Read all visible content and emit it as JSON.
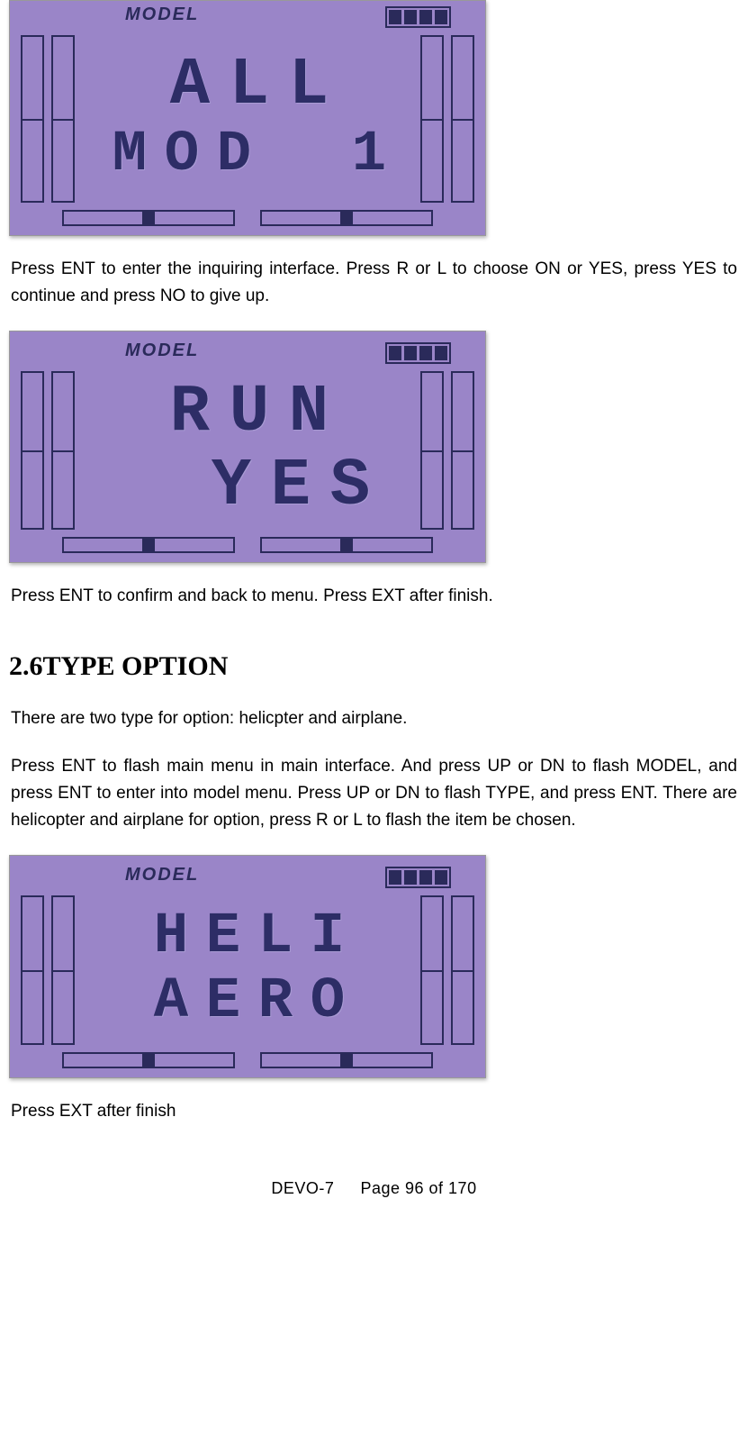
{
  "lcd": {
    "header_label": "MODEL",
    "screen1": {
      "line1": "ALL",
      "line2_left": "MOD",
      "line2_right": "1"
    },
    "screen2": {
      "line1": "RUN",
      "line2": "YES"
    },
    "screen3": {
      "line1": "HELI",
      "line2": "AERO"
    }
  },
  "paragraphs": {
    "p1": "Press ENT to enter the inquiring interface. Press R or L to choose ON or YES, press YES to continue and press NO to give up.",
    "p2": "Press ENT to confirm and back to menu. Press EXT after finish.",
    "p3": "There are two type for option: helicpter and airplane.",
    "p4": "Press ENT to flash main menu in main interface. And press UP or DN to flash MODEL, and press ENT to enter into model menu. Press UP or DN to flash TYPE, and press ENT. There are helicopter and airplane for option, press R or L to flash the item be chosen.",
    "p5": "Press EXT after finish"
  },
  "heading": "2.6TYPE OPTION",
  "footer": {
    "model": "DEVO-7",
    "page": "Page 96 of 170"
  }
}
